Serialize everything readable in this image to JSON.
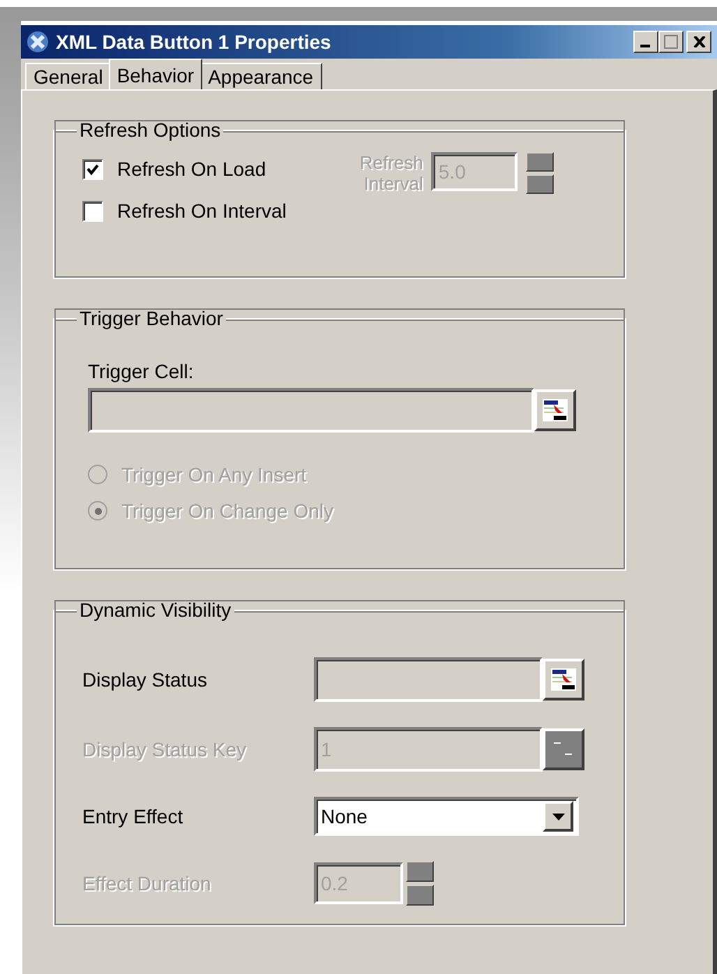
{
  "window": {
    "title": "XML Data Button 1 Properties"
  },
  "tabs": [
    {
      "label": "General",
      "selected": false
    },
    {
      "label": "Behavior",
      "selected": true
    },
    {
      "label": "Appearance",
      "selected": false
    }
  ],
  "refresh_options": {
    "title": "Refresh Options",
    "options": [
      {
        "label": "Refresh On Load",
        "checked": true
      },
      {
        "label": "Refresh On Interval",
        "checked": false
      }
    ],
    "interval": {
      "label": "Refresh Interval",
      "value": "5.0",
      "disabled": true
    }
  },
  "trigger_behavior": {
    "title": "Trigger Behavior",
    "cell_label": "Trigger Cell:",
    "radios": [
      {
        "label": "Trigger On Any Insert",
        "selected": false,
        "disabled": true
      },
      {
        "label": "Trigger On Change Only",
        "selected": true,
        "disabled": true
      }
    ]
  },
  "dynamic_visibility": {
    "title": "Dynamic Visibility",
    "rows": [
      {
        "kind": "picker",
        "label": "Display Status",
        "disabled": false
      },
      {
        "kind": "picker",
        "label": "Display Status Key",
        "value": "1",
        "disabled": true
      },
      {
        "kind": "select",
        "label": "Entry Effect",
        "value": "None",
        "disabled": false
      },
      {
        "kind": "spinner",
        "label": "Effect Duration",
        "value": "0.2",
        "disabled": true
      }
    ]
  }
}
